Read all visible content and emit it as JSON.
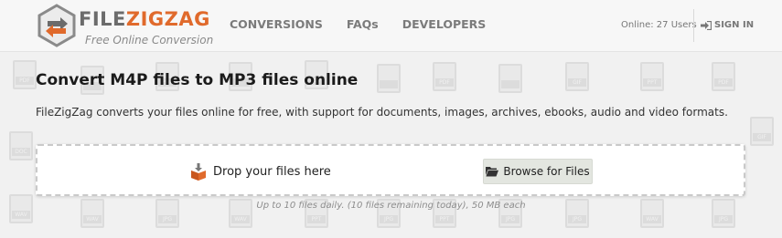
{
  "brand": {
    "name_part1": "FILE",
    "name_part2": "ZIGZAG",
    "tagline": "Free Online Conversion",
    "colors": {
      "orange": "#e06a2c",
      "gray": "#6b6b6b"
    }
  },
  "nav": {
    "items": [
      {
        "label": "CONVERSIONS"
      },
      {
        "label": "FAQs"
      },
      {
        "label": "DEVELOPERS"
      }
    ]
  },
  "header": {
    "online": "Online: 27 Users",
    "signin": "SIGN IN",
    "signin_icon": "sign-in-icon"
  },
  "main": {
    "title": "Convert M4P files to MP3 files online",
    "description": "FileZigZag converts your files online for free, with support for documents, images, archives, ebooks, audio and video formats.",
    "dropzone": {
      "drop_label": "Drop your files here",
      "drop_icon": "download-box-icon",
      "browse_label": "Browse for Files",
      "browse_icon": "folder-open-icon"
    },
    "limits": "Up to 10 files daily. (10 files remaining today), 50 MB each"
  }
}
